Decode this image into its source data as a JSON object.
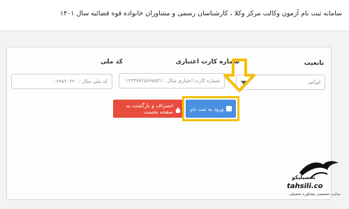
{
  "header": {
    "title": "سامانه ثبت نام آزمون وکالت مرکز وکلا ، کارشناسان رسمی و مشاوران خانواده قوه قضائیه سال ۱۴۰۱"
  },
  "form": {
    "nationality": {
      "label": "تابعیت",
      "value": "ایرانی"
    },
    "card_number": {
      "label": "شماره کارت اعتباری",
      "placeholder": "شماره کارت اعتباری مثال : ۱۲۳۴۷۸۲۵۶۷۸۵۴۱"
    },
    "national_code": {
      "label": "کد ملی",
      "placeholder": "کد ملی مثال : ۰۰۷۹۸۲۰۴۲۰"
    }
  },
  "buttons": {
    "register_label": "ورود به ثبت نام",
    "cancel_label": "انصراف و بازگشت به صفحه نخست"
  },
  "watermark": {
    "brand_name": "تحصیلیکو",
    "url": "tahsili.co",
    "tagline": "سایت تخصصی مشاوره تحصیلی"
  },
  "colors": {
    "register_button": "#4a90e2",
    "cancel_button": "#e84c3d",
    "annotation": "#f3bf10"
  },
  "icons": {
    "register": "login-icon",
    "cancel": "home-icon",
    "dropdown": "chevron-down-icon"
  }
}
